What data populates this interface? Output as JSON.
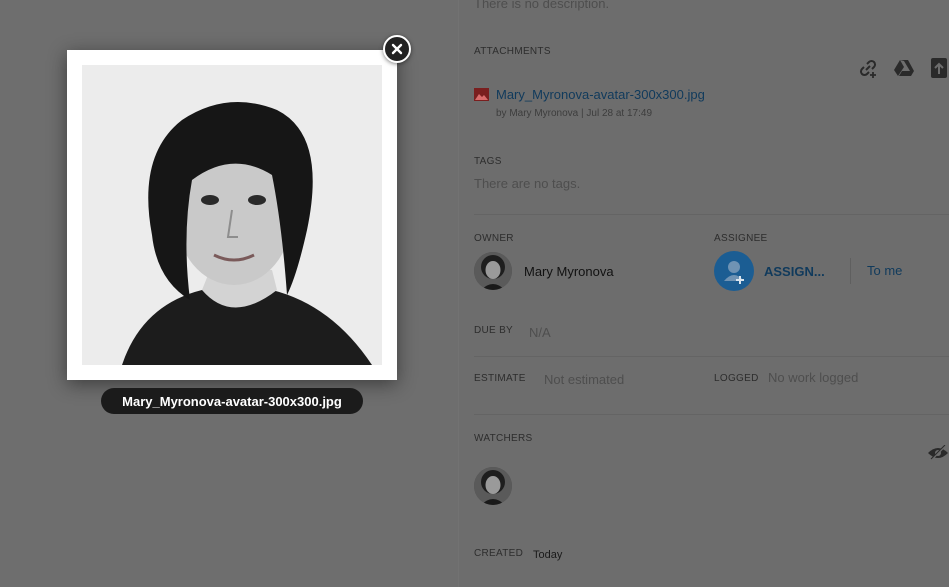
{
  "colors": {
    "overlay": "#6d6d6d",
    "accent_link": "#103a5c",
    "assign_button": "#1b5d93",
    "caption_bg": "#1b1b1b"
  },
  "panel": {
    "description_text": "There is no description.",
    "attachments": {
      "label": "ATTACHMENTS",
      "file_name": "Mary_Myronova-avatar-300x300.jpg",
      "file_meta": "by Mary Myronova | Jul 28 at 17:49",
      "icons": [
        "add-link-icon",
        "google-drive-icon",
        "upload-icon"
      ]
    },
    "tags": {
      "label": "TAGS",
      "empty_text": "There are no tags."
    },
    "owner": {
      "label": "OWNER",
      "name": "Mary Myronova"
    },
    "assignee": {
      "label": "ASSIGNEE",
      "assign_label": "ASSIGN...",
      "to_me_label": "To me"
    },
    "due_by": {
      "label": "DUE BY",
      "value": "N/A"
    },
    "estimate": {
      "label": "ESTIMATE",
      "value": "Not estimated"
    },
    "logged": {
      "label": "LOGGED",
      "value": "No work logged"
    },
    "watchers": {
      "label": "WATCHERS"
    },
    "created": {
      "label": "CREATED",
      "value": "Today"
    }
  },
  "lightbox": {
    "caption": "Mary_Myronova-avatar-300x300.jpg",
    "close_icon": "close-icon"
  }
}
